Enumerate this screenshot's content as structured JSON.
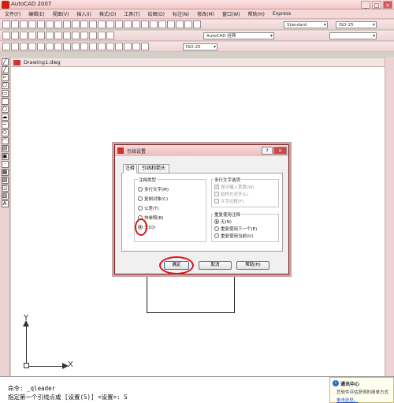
{
  "app": {
    "title": "AutoCAD 2007",
    "window_controls": [
      "_",
      "□",
      "×"
    ]
  },
  "menu": [
    "文件(F)",
    "编辑(E)",
    "视图(V)",
    "插入(I)",
    "格式(O)",
    "工具(T)",
    "绘图(D)",
    "标注(N)",
    "修改(M)",
    "窗口(W)",
    "帮助(H)",
    "Express"
  ],
  "toolbars": {
    "text_style": "Standard",
    "dim_style": "ISO-25",
    "workspace": "AutoCAD 经典",
    "dim_style_2": "ISO-25"
  },
  "drawing": {
    "tab_title": "Drawing1.dwg",
    "ucs_x": "X",
    "ucs_y": "Y"
  },
  "dialog": {
    "title": "引线设置",
    "help_btn": "?",
    "close_btn": "×",
    "tabs": [
      "注释",
      "引线和箭头"
    ],
    "annotation_type": {
      "title": "注释类型",
      "options": [
        "多行文字(M)",
        "复制对象(C)",
        "公差(T)",
        "块参照(B)",
        "无(O)"
      ],
      "selected": "无(O)"
    },
    "mtext_options": {
      "title": "多行文字选项",
      "options": [
        "提示输入宽度(W)",
        "始终左对齐(L)",
        "文字边框(F)"
      ]
    },
    "reuse": {
      "title": "重复使用注释",
      "options": [
        "无(N)",
        "重复使用下一个(E)",
        "重复使用当前(U)"
      ],
      "selected": "无(N)"
    },
    "buttons": {
      "ok": "确定",
      "cancel": "取消",
      "help": "帮助(H)"
    }
  },
  "command": {
    "line1": "命令: _qleader",
    "line2": "指定第一个引线点或 [设置(S)] <设置>: S"
  },
  "notification": {
    "title": "通讯中心",
    "text": "您软件评估获得的简单方式",
    "link": "单击此处。"
  },
  "colors": {
    "highlight": "#d9141c",
    "titlebar": "#f3c7c7"
  }
}
